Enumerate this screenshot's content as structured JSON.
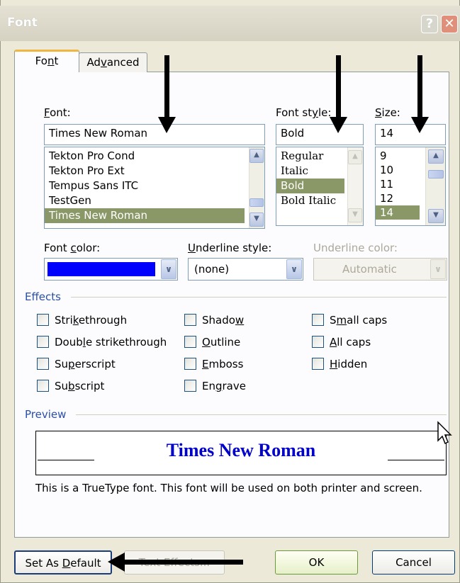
{
  "window": {
    "title": "Font",
    "help_label": "?",
    "close_label": "✕"
  },
  "tabs": [
    {
      "label": "Font",
      "accel": "n"
    },
    {
      "label": "Advanced",
      "accel": "v"
    }
  ],
  "font": {
    "label": "Font:",
    "value": "Times New Roman",
    "items": [
      "Tekton Pro Cond",
      "Tekton Pro Ext",
      "Tempus Sans ITC",
      "TestGen",
      "Times New Roman"
    ]
  },
  "style": {
    "label": "Font style:",
    "value": "Bold",
    "items": [
      "Regular",
      "Italic",
      "Bold",
      "Bold Italic"
    ]
  },
  "size": {
    "label": "Size:",
    "value": "14",
    "items": [
      "9",
      "10",
      "11",
      "12",
      "14"
    ]
  },
  "font_color": {
    "label": "Font color:",
    "color": "#0000ff"
  },
  "underline_style": {
    "label": "Underline style:",
    "value": "(none)"
  },
  "underline_color": {
    "label": "Underline color:",
    "value": "Automatic"
  },
  "effects": {
    "heading": "Effects",
    "items": [
      "Strikethrough",
      "Double strikethrough",
      "Superscript",
      "Subscript",
      "Shadow",
      "Outline",
      "Emboss",
      "Engrave",
      "Small caps",
      "All caps",
      "Hidden"
    ]
  },
  "preview": {
    "heading": "Preview",
    "sample": "Times New Roman",
    "sample_color": "#0000cc",
    "note": "This is a TrueType font. This font will be used on both printer and screen."
  },
  "buttons": {
    "set_default": "Set As Default",
    "text_effects": "Text Effects...",
    "ok": "OK",
    "cancel": "Cancel"
  },
  "cursor_icon": "mouse-pointer-icon"
}
